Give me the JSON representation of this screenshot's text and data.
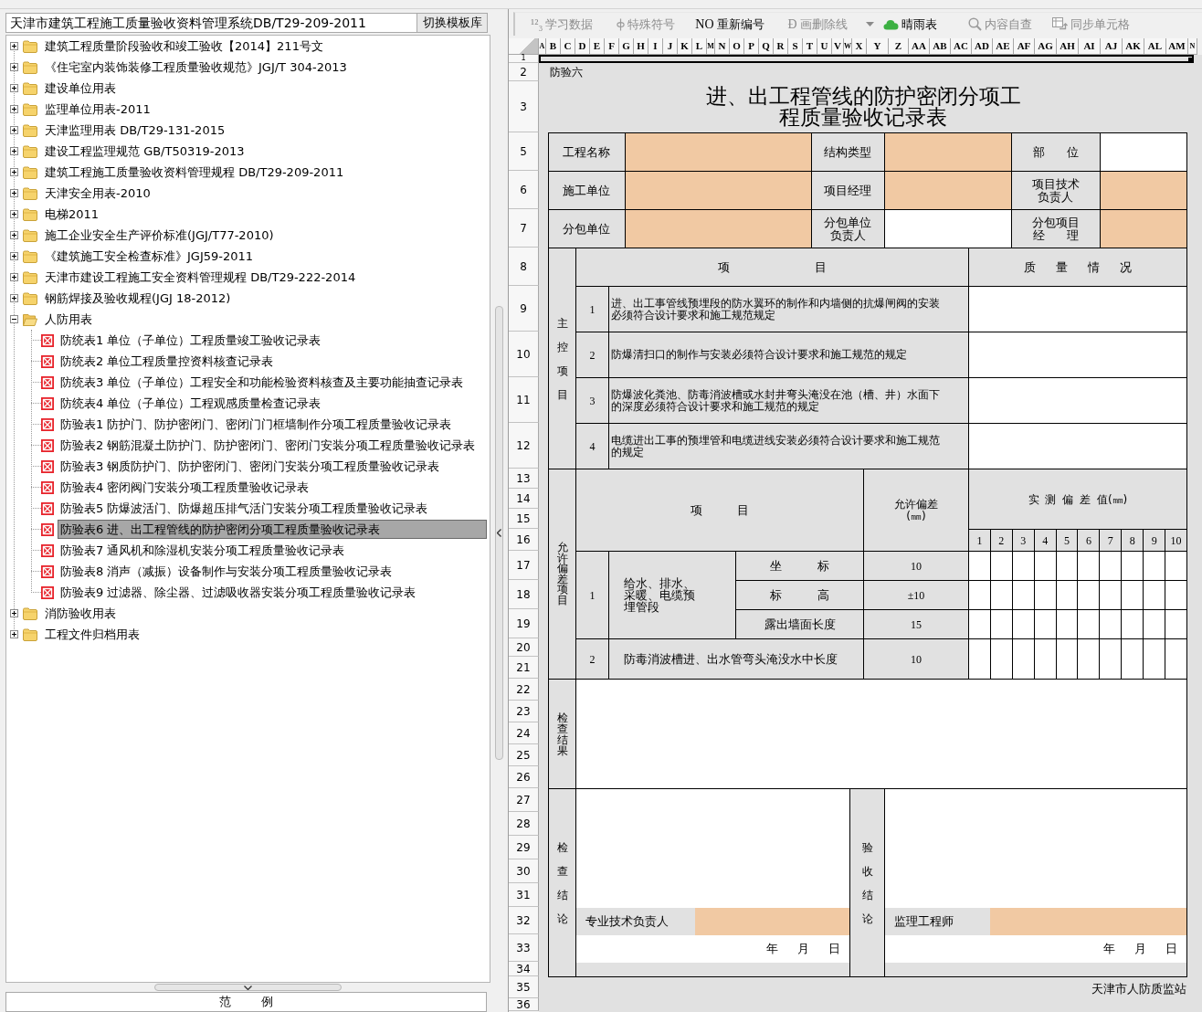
{
  "left_panel": {
    "template_title": "天津市建筑工程施工质量验收资料管理系统DB/T29-209-2011",
    "switch_button": "切换模板库",
    "tree": [
      {
        "label": "建筑工程质量阶段验收和竣工验收【2014】211号文",
        "expanded": false,
        "selected": false
      },
      {
        "label": "《住宅室内装饰装修工程质量验收规范》JGJ/T 304-2013",
        "expanded": false,
        "selected": false
      },
      {
        "label": "建设单位用表",
        "expanded": false,
        "selected": false
      },
      {
        "label": "监理单位用表-2011",
        "expanded": false,
        "selected": false
      },
      {
        "label": "天津监理用表 DB/T29-131-2015",
        "expanded": false,
        "selected": false
      },
      {
        "label": "建设工程监理规范 GB/T50319-2013",
        "expanded": false,
        "selected": false
      },
      {
        "label": "建筑工程施工质量验收资料管理规程 DB/T29-209-2011",
        "expanded": false,
        "selected": false
      },
      {
        "label": "天津安全用表-2010",
        "expanded": false,
        "selected": false
      },
      {
        "label": "电梯2011",
        "expanded": false,
        "selected": false
      },
      {
        "label": "施工企业安全生产评价标准(JGJ/T77-2010)",
        "expanded": false,
        "selected": false
      },
      {
        "label": "《建筑施工安全检查标准》JGJ59-2011",
        "expanded": false,
        "selected": false
      },
      {
        "label": "天津市建设工程施工安全资料管理规程 DB/T29-222-2014",
        "expanded": false,
        "selected": false
      },
      {
        "label": "钢筋焊接及验收规程(JGJ 18-2012)",
        "expanded": false,
        "selected": false
      },
      {
        "label": "人防用表",
        "expanded": true,
        "selected": false,
        "children": [
          {
            "label": "防统表1 单位（子单位）工程质量竣工验收记录表",
            "selected": false
          },
          {
            "label": "防统表2 单位工程质量控资料核查记录表",
            "selected": false
          },
          {
            "label": "防统表3 单位（子单位）工程安全和功能检验资料核查及主要功能抽查记录表",
            "selected": false
          },
          {
            "label": "防统表4 单位（子单位）工程观感质量检查记录表",
            "selected": false
          },
          {
            "label": "防验表1 防护门、防护密闭门、密闭门门框墙制作分项工程质量验收记录表",
            "selected": false
          },
          {
            "label": "防验表2 钢筋混凝土防护门、防护密闭门、密闭门安装分项工程质量验收记录表",
            "selected": false
          },
          {
            "label": "防验表3 钢质防护门、防护密闭门、密闭门安装分项工程质量验收记录表",
            "selected": false
          },
          {
            "label": "防验表4 密闭阀门安装分项工程质量验收记录表",
            "selected": false
          },
          {
            "label": "防验表5 防爆波活门、防爆超压排气活门安装分项工程质量验收记录表",
            "selected": false
          },
          {
            "label": "防验表6 进、出工程管线的防护密闭分项工程质量验收记录表",
            "selected": true
          },
          {
            "label": "防验表7 通风机和除湿机安装分项工程质量验收记录表",
            "selected": false
          },
          {
            "label": "防验表8 消声（减振）设备制作与安装分项工程质量验收记录表",
            "selected": false
          },
          {
            "label": "防验表9 过滤器、除尘器、过滤吸收器安装分项工程质量验收记录表",
            "selected": false
          }
        ]
      },
      {
        "label": "消防验收用表",
        "expanded": false,
        "selected": false
      },
      {
        "label": "工程文件归档用表",
        "expanded": false,
        "selected": false
      }
    ],
    "legend_title": "范 例"
  },
  "toolbar": [
    {
      "kind": "glyph",
      "icon_text": "¹²₃",
      "label": "学习数据",
      "disabled": true
    },
    {
      "kind": "symbol",
      "label": "特殊符号",
      "disabled": true
    },
    {
      "kind": "glyph",
      "icon_text": "NO",
      "label": "重新编号",
      "disabled": false
    },
    {
      "kind": "glyph",
      "icon_text": "Ð",
      "label": "画删除线",
      "disabled": true
    },
    {
      "kind": "dropdown",
      "disabled": true
    },
    {
      "kind": "weather",
      "label": "晴雨表",
      "disabled": false
    },
    {
      "kind": "search",
      "label": "内容自查",
      "disabled": true
    },
    {
      "kind": "sync",
      "label": "同步单元格",
      "disabled": true
    }
  ],
  "sheet": {
    "column_headers": [
      "A",
      "B",
      "C",
      "D",
      "E",
      "F",
      "G",
      "H",
      "I",
      "J",
      "K",
      "L",
      "M",
      "N",
      "O",
      "P",
      "Q",
      "R",
      "S",
      "T",
      "U",
      "V",
      "W",
      "X",
      "Y",
      "Z",
      "AA",
      "AB",
      "AC",
      "AD",
      "AE",
      "AF",
      "AG",
      "AH",
      "AI",
      "AJ",
      "AK",
      "AL",
      "AM",
      "N"
    ],
    "row_headers": [
      "1",
      "2",
      "3",
      "5",
      "6",
      "7",
      "8",
      "9",
      "10",
      "11",
      "12",
      "13",
      "14",
      "15",
      "16",
      "17",
      "18",
      "19",
      "20",
      "21",
      "22",
      "23",
      "24",
      "25",
      "26",
      "27",
      "28",
      "29",
      "30",
      "31",
      "32",
      "33",
      "34",
      "35",
      "36"
    ],
    "form_code": "防验六",
    "title": "进、出工程管线的防护密闭分项工程质量验收记录表",
    "info_fields": [
      {
        "label": "工程名称",
        "highlighted": true
      },
      {
        "label": "结构类型",
        "highlighted": true
      },
      {
        "label": "部 位",
        "highlighted": false
      },
      {
        "label": "施工单位",
        "highlighted": true
      },
      {
        "label": "项目经理",
        "highlighted": true
      },
      {
        "label": "项目技术负责人",
        "highlighted": true
      },
      {
        "label": "分包单位",
        "highlighted": true
      },
      {
        "label": "分包单位负责人",
        "highlighted": false
      },
      {
        "label": "分包项目经 理",
        "highlighted": true
      }
    ],
    "main_control": {
      "side_label": "主控项目",
      "item_header": "项 目",
      "quality_header": "质 量 情 况",
      "items": [
        {
          "number": "1",
          "text": "进、出工事管线预埋段的防水翼环的制作和内墙侧的抗爆闸阀的安装必须符合设计要求和施工规范规定"
        },
        {
          "number": "2",
          "text": "防爆清扫口的制作与安装必须符合设计要求和施工规范的规定"
        },
        {
          "number": "3",
          "text": "防爆波化粪池、防毒消波槽或水封井弯头淹没在池（槽、井）水面下的深度必须符合设计要求和施工规范的规定"
        },
        {
          "number": "4",
          "text": "电缆进出工事的预埋管和电缆进线安装必须符合设计要求和施工规范的规定"
        }
      ]
    },
    "deviation": {
      "side_label": "允许偏差项目",
      "item_header": "项 目",
      "tolerance_header": "允许偏差(㎜)",
      "measured_header": "实 测 偏 差 值(㎜)",
      "measure_numbers": [
        "1",
        "2",
        "3",
        "4",
        "5",
        "6",
        "7",
        "8",
        "9",
        "10"
      ],
      "groups": [
        {
          "number": "1",
          "name": "给水、排水、采暖、电缆预埋管段",
          "rows": [
            {
              "item": "坐 标",
              "tolerance": "10"
            },
            {
              "item": "标 高",
              "tolerance": "±10"
            },
            {
              "item": "露出墙面长度",
              "tolerance": "15"
            }
          ]
        },
        {
          "number": "2",
          "rows": [
            {
              "item": "防毒消波槽进、出水管弯头淹没水中长度",
              "tolerance": "10"
            }
          ]
        }
      ]
    },
    "check_result": {
      "side_label": "检查结果"
    },
    "conclusions": [
      {
        "side_label": "检查结论",
        "signer": "专业技术负责人",
        "signer_highlighted": true,
        "date": "年 月 日"
      },
      {
        "side_label": "验收结论",
        "signer": "监理工程师",
        "signer_highlighted": true,
        "date": "年 月 日"
      }
    ],
    "footer": "天津市人防质监站"
  }
}
